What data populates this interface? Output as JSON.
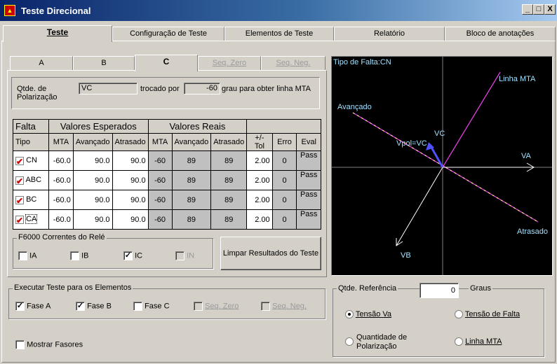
{
  "window": {
    "title": "Teste Direcional",
    "minimize": "_",
    "maximize": "□",
    "close": "X"
  },
  "main_tabs": [
    "Teste",
    "Configuração de Teste",
    "Elementos de Teste",
    "Relatório",
    "Bloco de anotações"
  ],
  "sub_tabs": [
    "A",
    "B",
    "C",
    "Seq. Zero",
    "Seq. Neg."
  ],
  "polarization": {
    "label": "Qtde. de Polarização",
    "value": "VC",
    "swapped_label": "trocado por",
    "angle": "-60",
    "suffix": "grau para obter linha MTA"
  },
  "grid": {
    "col_falta": "Falta",
    "col_tipo": "Tipo",
    "group_expected": "Valores Esperados",
    "group_real": "Valores Reais",
    "sub_headers": [
      "MTA",
      "Avançado",
      "Atrasado",
      "MTA",
      "Avançado",
      "Atrasado",
      "+/- Tol",
      "Erro",
      "Eval"
    ],
    "rows": [
      {
        "tipo": "CN",
        "cells": [
          "-60.0",
          "90.0",
          "90.0",
          "-60",
          "89",
          "89",
          "2.00",
          "0",
          "Pass"
        ]
      },
      {
        "tipo": "ABC",
        "cells": [
          "-60.0",
          "90.0",
          "90.0",
          "-60",
          "89",
          "89",
          "2.00",
          "0",
          "Pass"
        ]
      },
      {
        "tipo": "BC",
        "cells": [
          "-60.0",
          "90.0",
          "90.0",
          "-60",
          "89",
          "89",
          "2.00",
          "0",
          "Pass"
        ]
      },
      {
        "tipo": "CA",
        "cells": [
          "-60.0",
          "90.0",
          "90.0",
          "-60",
          "89",
          "89",
          "2.00",
          "0",
          "Pass"
        ]
      }
    ]
  },
  "relay_currents": {
    "title": "F6000 Correntes do Relé",
    "items": [
      {
        "label": "IA",
        "checked": false,
        "disabled": false
      },
      {
        "label": "IB",
        "checked": false,
        "disabled": false
      },
      {
        "label": "IC",
        "checked": true,
        "disabled": false
      },
      {
        "label": "IN",
        "checked": false,
        "disabled": true
      }
    ]
  },
  "clear_button": "Limpar Resultados do Teste",
  "execute": {
    "title": "Executar Teste para os Elementos",
    "items": [
      {
        "label": "Fase A",
        "checked": true,
        "disabled": false
      },
      {
        "label": "Fase B",
        "checked": true,
        "disabled": false
      },
      {
        "label": "Fase C",
        "checked": false,
        "disabled": false
      },
      {
        "label": "Seq. Zero",
        "checked": false,
        "disabled": true
      },
      {
        "label": "Seq. Neg.",
        "checked": false,
        "disabled": true
      }
    ]
  },
  "show_phasors": {
    "label": "Mostrar Fasores",
    "checked": false
  },
  "graph": {
    "fault_type": "Tipo de Falta:CN",
    "labels": {
      "mta": "Linha MTA",
      "advanced": "Avançado",
      "delayed": "Atrasado",
      "va": "VA",
      "vb": "VB",
      "vc": "VC",
      "vpol": "Vpol=VC"
    },
    "colors": {
      "mta": "#e040e0",
      "line": "#ffffff",
      "vpol": "#5050ff",
      "text": "#a0e0ff"
    }
  },
  "reference": {
    "label": "Qtde. Referência",
    "value": "0",
    "unit": "Graus",
    "options": [
      {
        "label": "Tensão Va",
        "selected": true
      },
      {
        "label": "Tensão de Falta",
        "selected": false
      },
      {
        "label": "Quantidade de Polarização",
        "selected": false
      },
      {
        "label": "Linha MTA",
        "selected": false
      }
    ]
  }
}
